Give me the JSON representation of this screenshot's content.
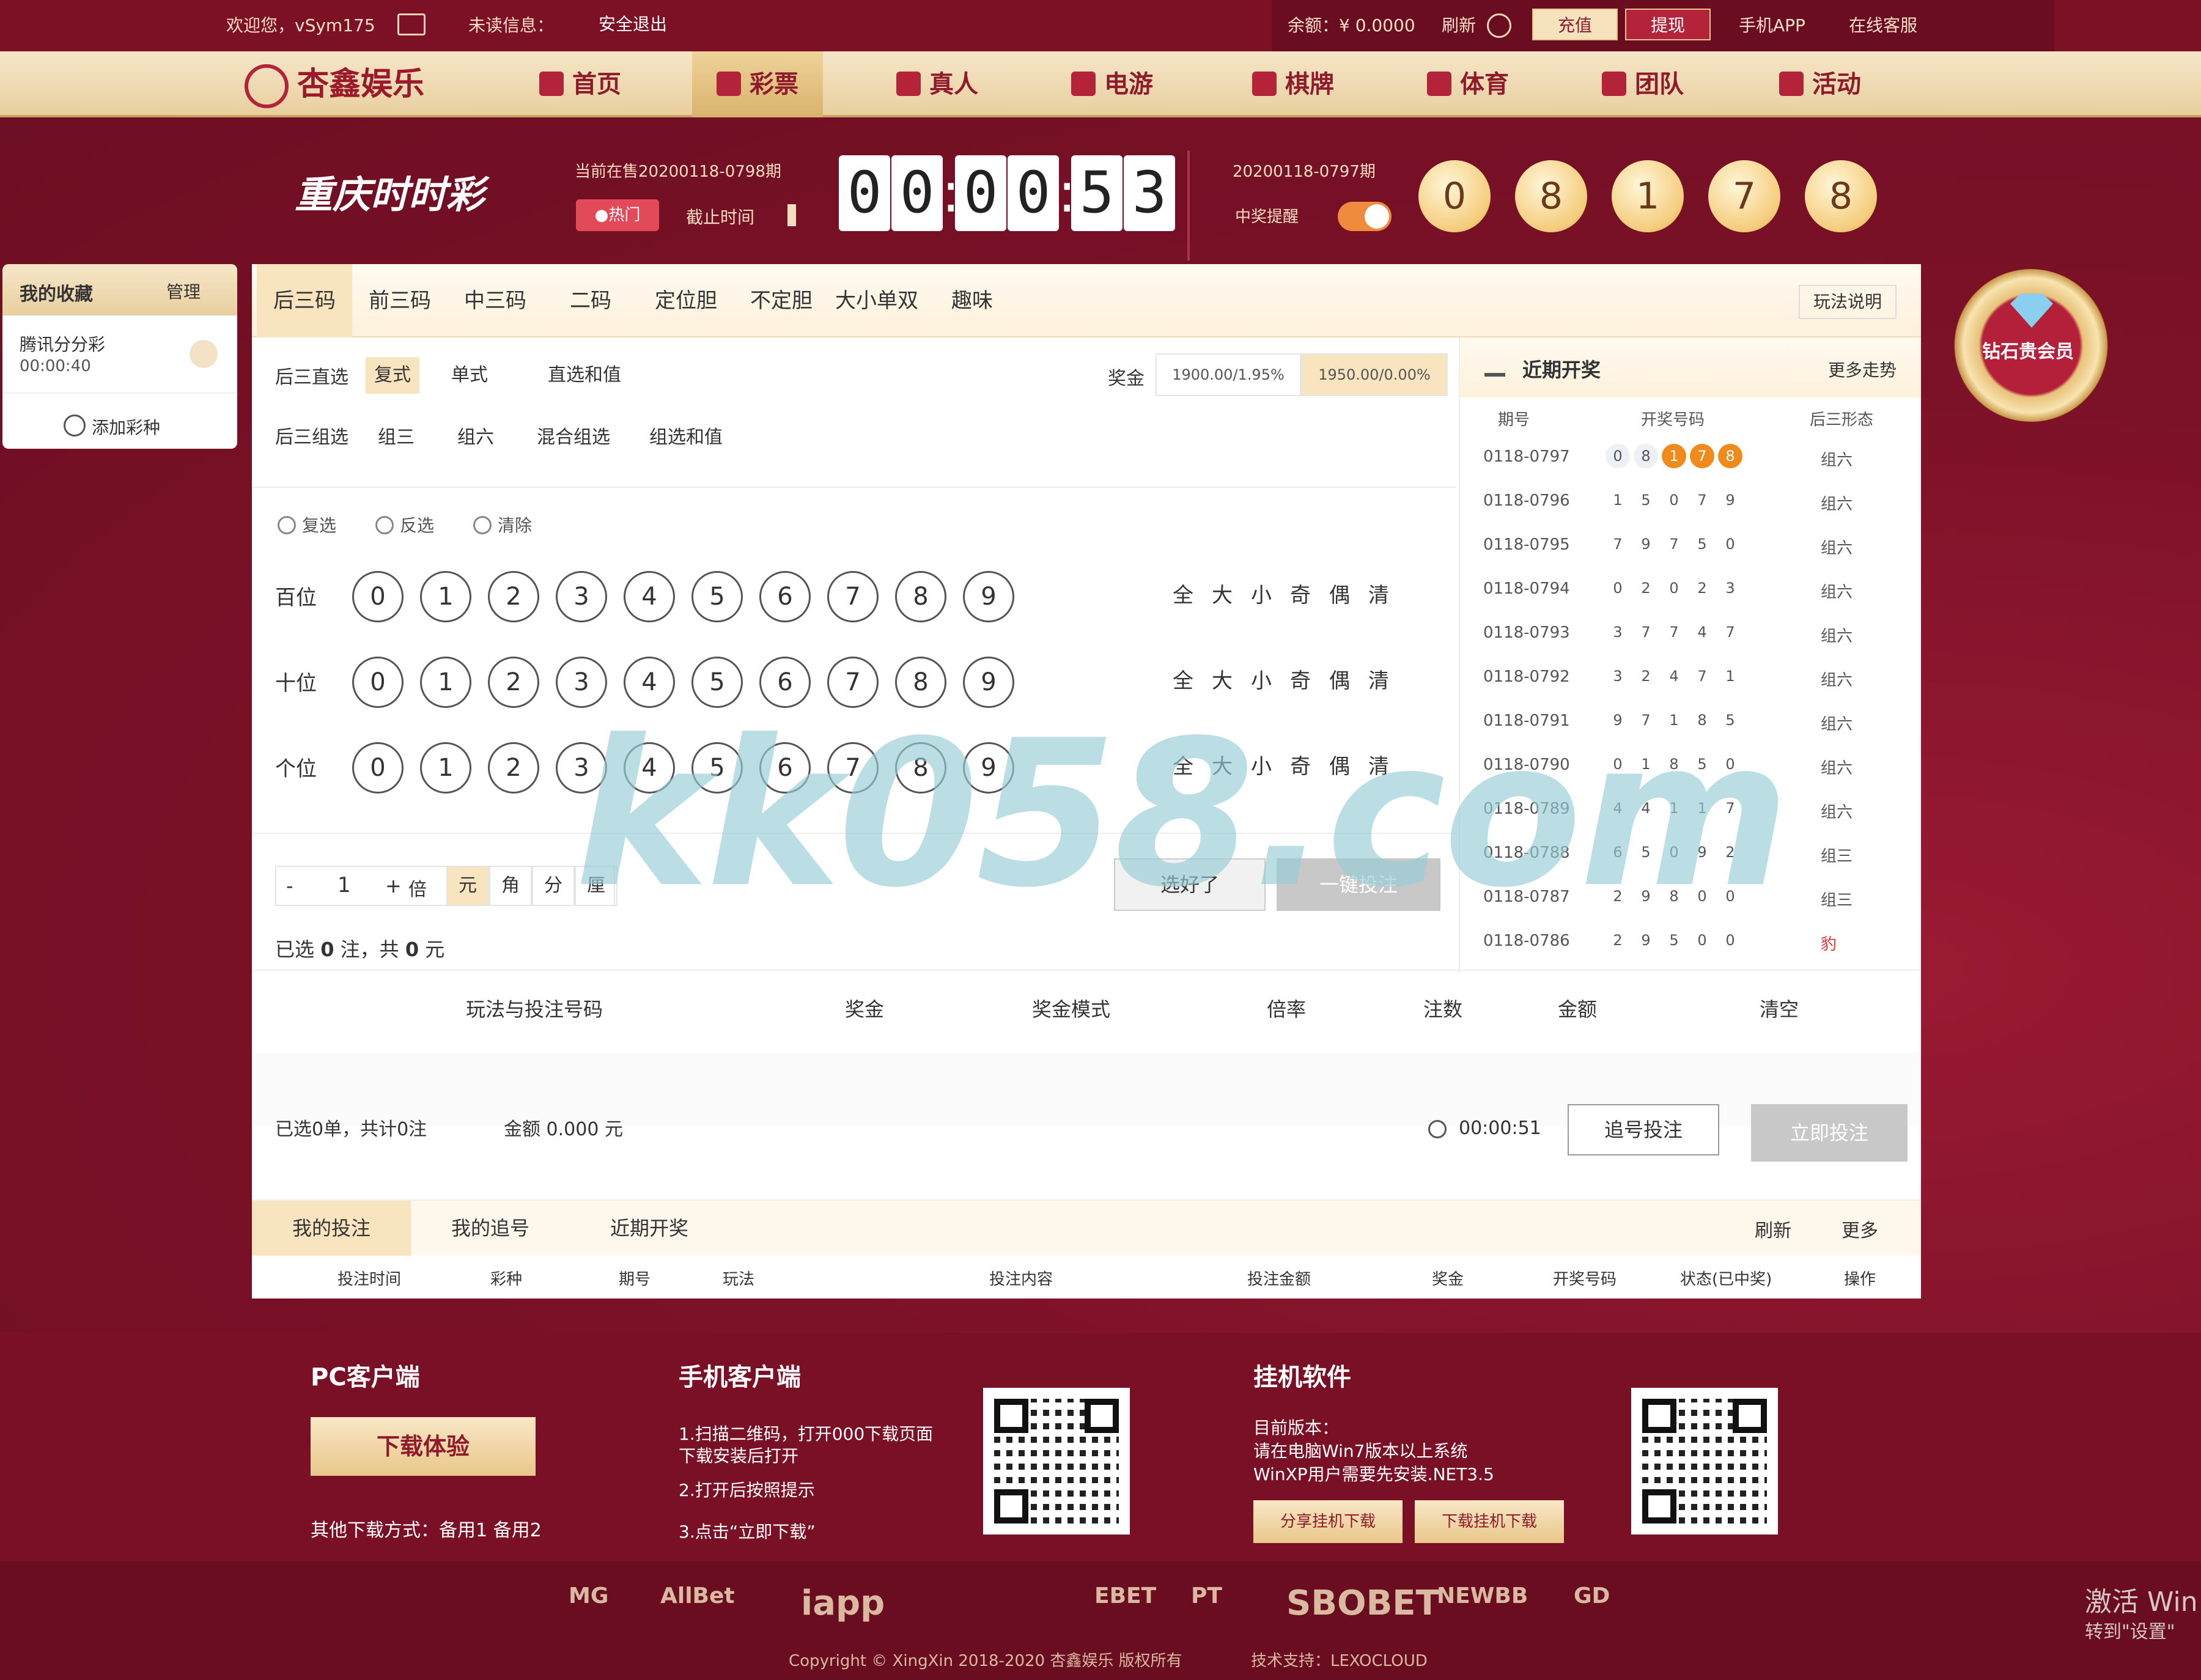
{
  "topbar": {
    "welcome": "欢迎您，vSym175",
    "unread": "未读信息：",
    "security": "安全退出",
    "balance": "余额：¥ 0.0000",
    "refresh": "刷新",
    "deposit": "充值",
    "withdraw": "提现",
    "app": "手机APP",
    "service": "在线客服"
  },
  "nav": {
    "logo": "杏鑫娱乐",
    "items": [
      {
        "label": "首页",
        "icon": "home-icon"
      },
      {
        "label": "彩票",
        "icon": "lottery-icon",
        "active": true
      },
      {
        "label": "真人",
        "icon": "live-icon"
      },
      {
        "label": "电游",
        "icon": "slot-icon"
      },
      {
        "label": "棋牌",
        "icon": "cards-icon"
      },
      {
        "label": "体育",
        "icon": "trophy-icon"
      },
      {
        "label": "团队",
        "icon": "team-icon"
      },
      {
        "label": "活动",
        "icon": "gift-icon"
      }
    ]
  },
  "header": {
    "game_logo": "重庆时时彩",
    "current_issue": "当前在售20200118-0798期",
    "hot_tag": "●热门",
    "hint": "截止时间",
    "timer": [
      "0",
      "0",
      "0",
      "0",
      "5",
      "3"
    ],
    "last_issue": "20200118-0797期",
    "prize_toggle": "中奖提醒",
    "last_result": [
      "0",
      "8",
      "1",
      "7",
      "8"
    ]
  },
  "sidebar": {
    "title": "我的收藏",
    "more": "管理",
    "item_name": "腾讯分分彩",
    "item_time": "00:00:40",
    "add": "添加彩种"
  },
  "tabs": [
    "后三码",
    "前三码",
    "中三码",
    "二码",
    "定位胆",
    "不定胆",
    "大小单双",
    "趣味"
  ],
  "tabs_right": "玩法说明",
  "play": {
    "group1_label": "后三直选",
    "group1_items": [
      "复式",
      "单式",
      "直选和值"
    ],
    "group2_label": "后三组选",
    "group2_items": [
      "组三",
      "组六",
      "混合组选",
      "组选和值"
    ],
    "prize_label": "奖金",
    "prize_options": [
      "1900.00/1.95%",
      "1950.00/0.00%"
    ],
    "modes": [
      "复选",
      "反选",
      "清除"
    ]
  },
  "number_rows": [
    {
      "label": "百位",
      "quick": [
        "全",
        "大",
        "小",
        "奇",
        "偶",
        "清"
      ]
    },
    {
      "label": "十位",
      "quick": [
        "全",
        "大",
        "小",
        "奇",
        "偶",
        "清"
      ]
    },
    {
      "label": "个位",
      "quick": [
        "全",
        "大",
        "小",
        "奇",
        "偶",
        "清"
      ]
    }
  ],
  "digits": [
    "0",
    "1",
    "2",
    "3",
    "4",
    "5",
    "6",
    "7",
    "8",
    "9"
  ],
  "bet": {
    "minus": "-",
    "multiple": "1",
    "plus": "+",
    "multiple_unit": "倍",
    "units": [
      "元",
      "角",
      "分",
      "厘"
    ],
    "summary_a": "已选",
    "summary_count": "0",
    "summary_b": "注，共",
    "summary_amount": "0",
    "summary_c": "元",
    "add_button": "选好了",
    "quick_bet": "一键投注"
  },
  "cart": {
    "headers": [
      "玩法与投注号码",
      "奖金",
      "奖金模式",
      "倍率",
      "注数",
      "金额",
      "清空"
    ],
    "summary": "已选0单，共计0注",
    "total": "金额 0.000 元",
    "countdown": "00:00:51",
    "trace": "追号投注",
    "submit": "立即投注"
  },
  "history": {
    "title": "近期开奖",
    "more": "更多走势",
    "headers": [
      "期号",
      "开奖号码",
      "后三形态"
    ],
    "rows": [
      {
        "issue": "0118-0797",
        "nums": [
          "0",
          "8",
          "1",
          "7",
          "8"
        ],
        "form": "组六"
      },
      {
        "issue": "0118-0796",
        "nums": [
          "1",
          "5",
          "0",
          "7",
          "9"
        ],
        "form": "组六"
      },
      {
        "issue": "0118-0795",
        "nums": [
          "7",
          "9",
          "7",
          "5",
          "0"
        ],
        "form": "组六"
      },
      {
        "issue": "0118-0794",
        "nums": [
          "0",
          "2",
          "0",
          "2",
          "3"
        ],
        "form": "组六"
      },
      {
        "issue": "0118-0793",
        "nums": [
          "3",
          "7",
          "7",
          "4",
          "7"
        ],
        "form": "组六"
      },
      {
        "issue": "0118-0792",
        "nums": [
          "3",
          "2",
          "4",
          "7",
          "1"
        ],
        "form": "组六"
      },
      {
        "issue": "0118-0791",
        "nums": [
          "9",
          "7",
          "1",
          "8",
          "5"
        ],
        "form": "组六"
      },
      {
        "issue": "0118-0790",
        "nums": [
          "0",
          "1",
          "8",
          "5",
          "0"
        ],
        "form": "组六"
      },
      {
        "issue": "0118-0789",
        "nums": [
          "4",
          "4",
          "1",
          "1",
          "7"
        ],
        "form": "组六"
      },
      {
        "issue": "0118-0788",
        "nums": [
          "6",
          "5",
          "0",
          "9",
          "2"
        ],
        "form": "组三"
      },
      {
        "issue": "0118-0787",
        "nums": [
          "2",
          "9",
          "8",
          "0",
          "0"
        ],
        "form": "组三"
      },
      {
        "issue": "0118-0786",
        "nums": [
          "2",
          "9",
          "5",
          "0",
          "0"
        ],
        "form": "豹"
      }
    ]
  },
  "records": {
    "tabs": [
      "我的投注",
      "我的追号",
      "近期开奖"
    ],
    "refresh": "刷新",
    "more": "更多",
    "headers": [
      "投注时间",
      "彩种",
      "期号",
      "玩法",
      "投注内容",
      "投注金额",
      "奖金",
      "开奖号码",
      "状态(已中奖)",
      "操作"
    ]
  },
  "footer": {
    "pc_title": "PC客户端",
    "pc_button": "下载体验",
    "pc_note": "其他下载方式：备用1  备用2",
    "mobile_title": "手机客户端",
    "mobile_steps": [
      "1.扫描二维码，打开000下载页面",
      "下载安装后打开",
      "2.打开后按照提示",
      "3.点击“立即下载”"
    ],
    "hang_title": "挂机软件",
    "hang_desc": [
      "目前版本：",
      "请在电脑Win7版本以上系统",
      "WinXP用户需要先安装.NET3.5"
    ],
    "hang_buttons": [
      "分享挂机下载",
      "下载挂机下载"
    ]
  },
  "partners": [
    "MG",
    "AllBet",
    "iapp",
    "EBET",
    "PT",
    "SBOBET",
    "NEWBB",
    "GD"
  ],
  "copyright": "Copyright © XingXin 2018-2020 杏鑫娱乐 版权所有",
  "tech": "技术支持：LEXOCLOUD",
  "activation": [
    "激活 Win",
    "转到\"设置\""
  ],
  "vip_badge": "钻石贵会员",
  "watermark": "kk058.com"
}
